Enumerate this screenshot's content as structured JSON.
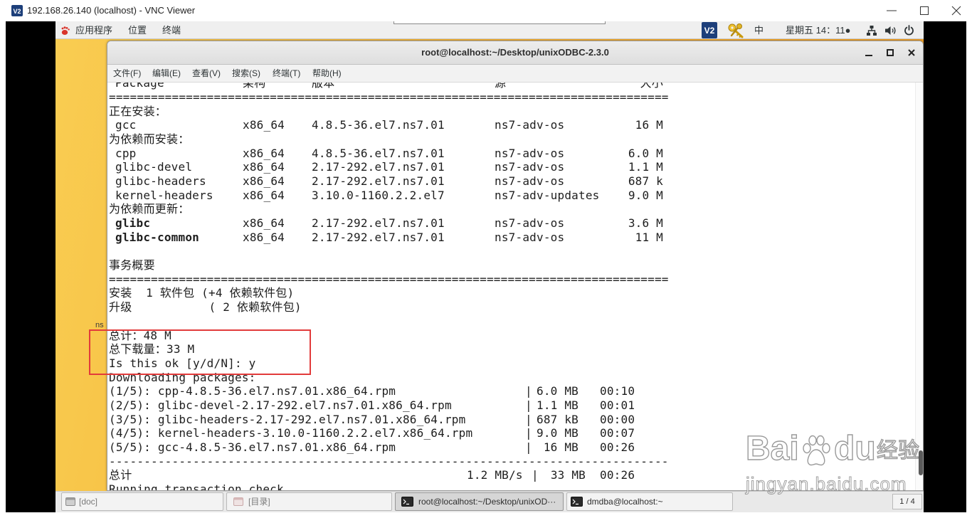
{
  "vnc_window": {
    "logo": "V2",
    "title": "192.168.26.140 (localhost) - VNC Viewer"
  },
  "gnome_panel": {
    "menu_applications": "应用程序",
    "menu_places": "位置",
    "menu_terminal": "终端",
    "vnc_logo": "V2",
    "input_method": "中",
    "clock": "星期五 14：11●"
  },
  "desktop": {
    "icon_label": "ns"
  },
  "terminal_window": {
    "title": "root@localhost:~/Desktop/unixODBC-2.3.0",
    "menu": [
      "文件(F)",
      "编辑(E)",
      "查看(V)",
      "搜索(S)",
      "终端(T)",
      "帮助(H)"
    ],
    "output": {
      "table_header": {
        "name": "Package",
        "arch": "架构",
        "version": "版本",
        "repo": "源",
        "size": "大小"
      },
      "separator_eq": "================================================================================",
      "installing": {
        "title": "正在安装：",
        "rows": [
          {
            "name": "gcc",
            "arch": "x86_64",
            "version": "4.8.5-36.el7.ns7.01",
            "repo": "ns7-adv-os",
            "size": "16 M"
          }
        ]
      },
      "dep_installing": {
        "title": "为依赖而安装：",
        "rows": [
          {
            "name": "cpp",
            "arch": "x86_64",
            "version": "4.8.5-36.el7.ns7.01",
            "repo": "ns7-adv-os",
            "size": "6.0 M"
          },
          {
            "name": "glibc-devel",
            "arch": "x86_64",
            "version": "2.17-292.el7.ns7.01",
            "repo": "ns7-adv-os",
            "size": "1.1 M"
          },
          {
            "name": "glibc-headers",
            "arch": "x86_64",
            "version": "2.17-292.el7.ns7.01",
            "repo": "ns7-adv-os",
            "size": "687 k"
          },
          {
            "name": "kernel-headers",
            "arch": "x86_64",
            "version": "3.10.0-1160.2.2.el7",
            "repo": "ns7-adv-updates",
            "size": "9.0 M"
          }
        ]
      },
      "dep_updating": {
        "title": "为依赖而更新：",
        "rows": [
          {
            "name": "glibc",
            "arch": "x86_64",
            "version": "2.17-292.el7.ns7.01",
            "repo": "ns7-adv-os",
            "size": "3.6 M"
          },
          {
            "name": "glibc-common",
            "arch": "x86_64",
            "version": "2.17-292.el7.ns7.01",
            "repo": "ns7-adv-os",
            "size": "11 M"
          }
        ]
      },
      "transaction_summary": "事务概要",
      "summary_install": "安装  1 软件包 (+4 依赖软件包)",
      "summary_upgrade": "升级           ( 2 依赖软件包)",
      "total": "总计：48 M",
      "total_download": "总下载量：33 M",
      "prompt": "Is this ok [y/d/N]: y",
      "downloading_title": "Downloading packages:",
      "col_divider": "|",
      "downloads": [
        {
          "file": "(1/5): cpp-4.8.5-36.el7.ns7.01.x86_64.rpm",
          "size": "6.0 MB",
          "time": "00:10"
        },
        {
          "file": "(2/5): glibc-devel-2.17-292.el7.ns7.01.x86_64.rpm",
          "size": "1.1 MB",
          "time": "00:01"
        },
        {
          "file": "(3/5): glibc-headers-2.17-292.el7.ns7.01.x86_64.rpm",
          "size": "687 kB",
          "time": "00:00"
        },
        {
          "file": "(4/5): kernel-headers-3.10.0-1160.2.2.el7.x86_64.rpm",
          "size": "9.0 MB",
          "time": "00:07"
        },
        {
          "file": "(5/5): gcc-4.8.5-36.el7.ns7.01.x86_64.rpm",
          "size": "16 MB",
          "time": "00:26"
        }
      ],
      "separator_dash": "--------------------------------------------------------------------------------",
      "total_line": {
        "label": "总计",
        "rate": "1.2 MB/s",
        "size": "33 MB",
        "time": "00:26"
      },
      "running": "Running transaction check"
    }
  },
  "taskbar": {
    "items": [
      {
        "label": "[doc]"
      },
      {
        "label": "[目录]"
      },
      {
        "label": "root@localhost:~/Desktop/unixOD···"
      },
      {
        "label": "dmdba@localhost:~"
      }
    ],
    "workspace": "1 / 4"
  },
  "watermark": {
    "brand_a": "Bai",
    "brand_b": "du",
    "brand_cn": "经验",
    "url": "jingyan.baidu.com"
  },
  "colors": {
    "annotation_red": "#e23b3b",
    "desktop_orange": "#f6b233",
    "vnc_logo_blue": "#1d3f7a"
  }
}
